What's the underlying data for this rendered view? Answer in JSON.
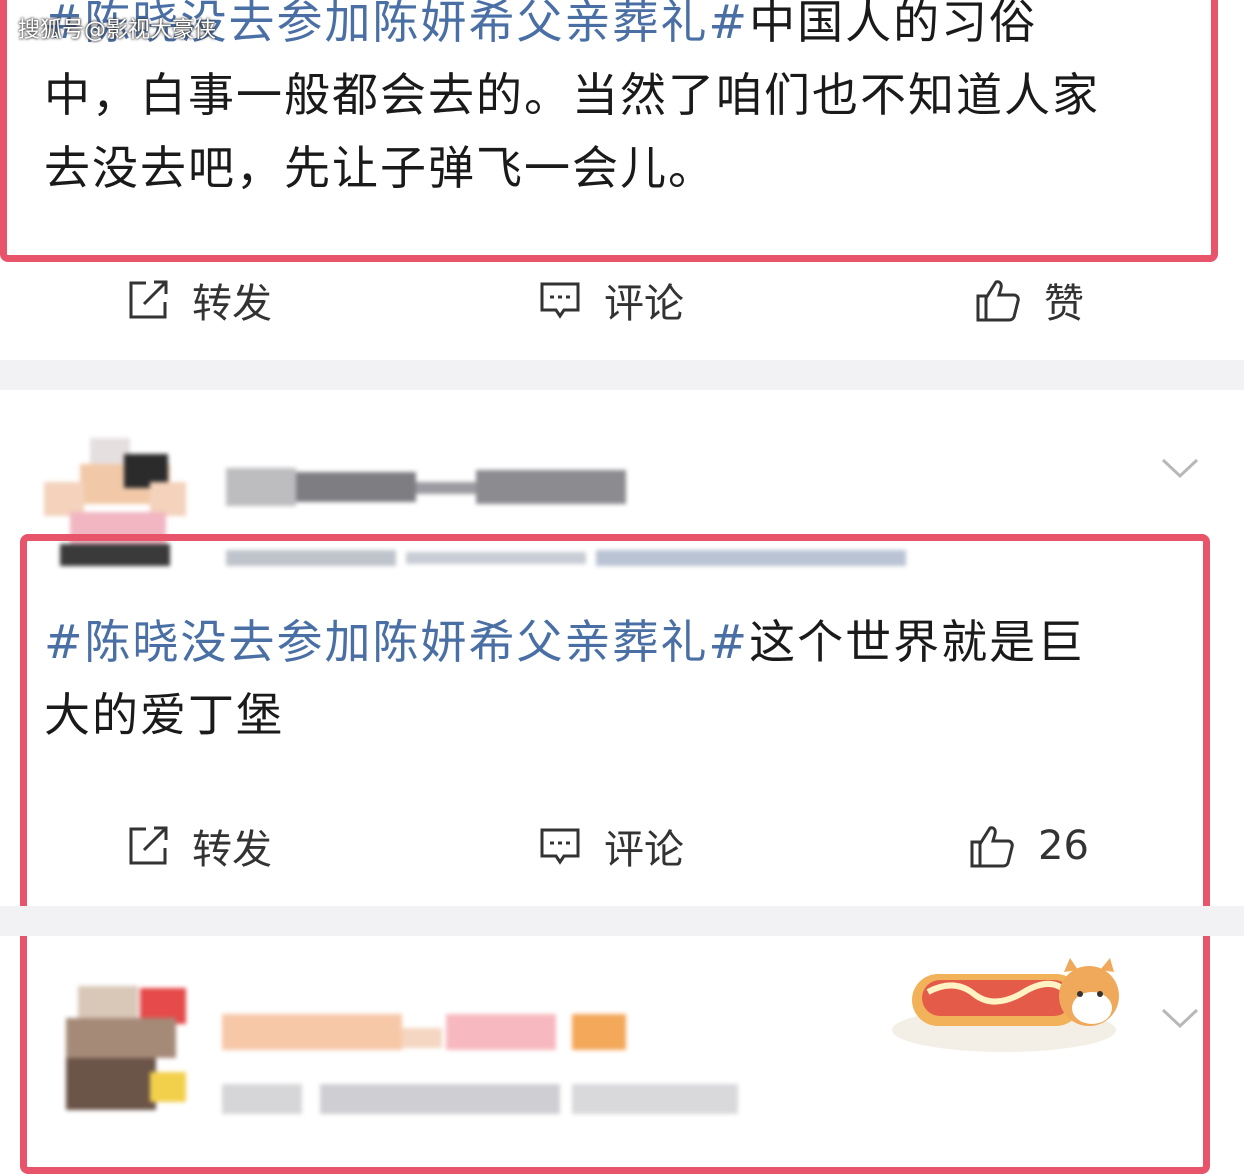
{
  "watermark": "搜狐号@影视大豪侠",
  "post1": {
    "line1_tag": "#陈晓没去参加陈妍希父亲葬礼#",
    "line1_text": "中国人的习俗",
    "line2": "中，白事一般都会去的。当然了咱们也不知道人家",
    "line3": "去没去吧，先让子弹飞一会儿。",
    "actions": {
      "repost": "转发",
      "comment": "评论",
      "like": "赞"
    }
  },
  "post2": {
    "tag": "#陈晓没去参加陈妍希父亲葬礼#",
    "line1_text": "这个世界就是巨",
    "line2": "大的爱丁堡",
    "actions": {
      "repost": "转发",
      "comment": "评论",
      "like": "26"
    }
  },
  "icons": [
    "repost-icon",
    "comment-icon",
    "thumbs-up-icon",
    "chevron-down-icon"
  ],
  "colors": {
    "frame": "#e8546a",
    "hashtag": "#4a6fa5",
    "separator": "#f2f2f4"
  }
}
